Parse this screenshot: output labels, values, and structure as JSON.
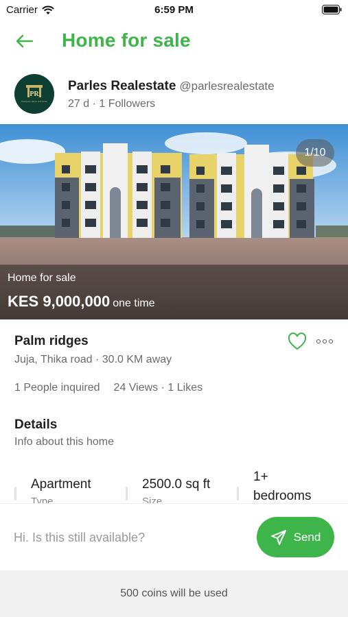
{
  "status_bar": {
    "carrier": "Carrier",
    "time": "6:59 PM"
  },
  "header": {
    "title": "Home for sale"
  },
  "seller": {
    "name": "Parles Realestate",
    "handle": "@parlesrealestate",
    "meta": "27 d · 1 Followers",
    "logo_text": "PR",
    "logo_tagline": "PARLES REAL ESTATE"
  },
  "hero": {
    "counter": "1/10",
    "label": "Home for sale",
    "price": "KES 9,000,000",
    "price_unit": "one time"
  },
  "listing": {
    "title": "Palm ridges",
    "location": "Juja, Thika road · 30.0 KM away",
    "inquired": "1  People inquired",
    "views_likes": "24  Views · 1 Likes",
    "liked": false
  },
  "details": {
    "title": "Details",
    "subtitle": "Info about this home"
  },
  "specs": [
    {
      "value": "Apartment",
      "label": "Type"
    },
    {
      "value": "2500.0 sq ft",
      "label": "Size"
    },
    {
      "value": "1+ bedrooms",
      "label": ""
    }
  ],
  "composer": {
    "placeholder": "Hi. Is this still available?",
    "send_label": "Send"
  },
  "footer": {
    "coins_text": "500 coins will be used"
  },
  "colors": {
    "accent": "#3db54a",
    "avatar_bg": "#0e3f32"
  },
  "icons": [
    "back-arrow-icon",
    "wifi-icon",
    "battery-icon",
    "heart-icon",
    "more-icon",
    "send-icon"
  ]
}
